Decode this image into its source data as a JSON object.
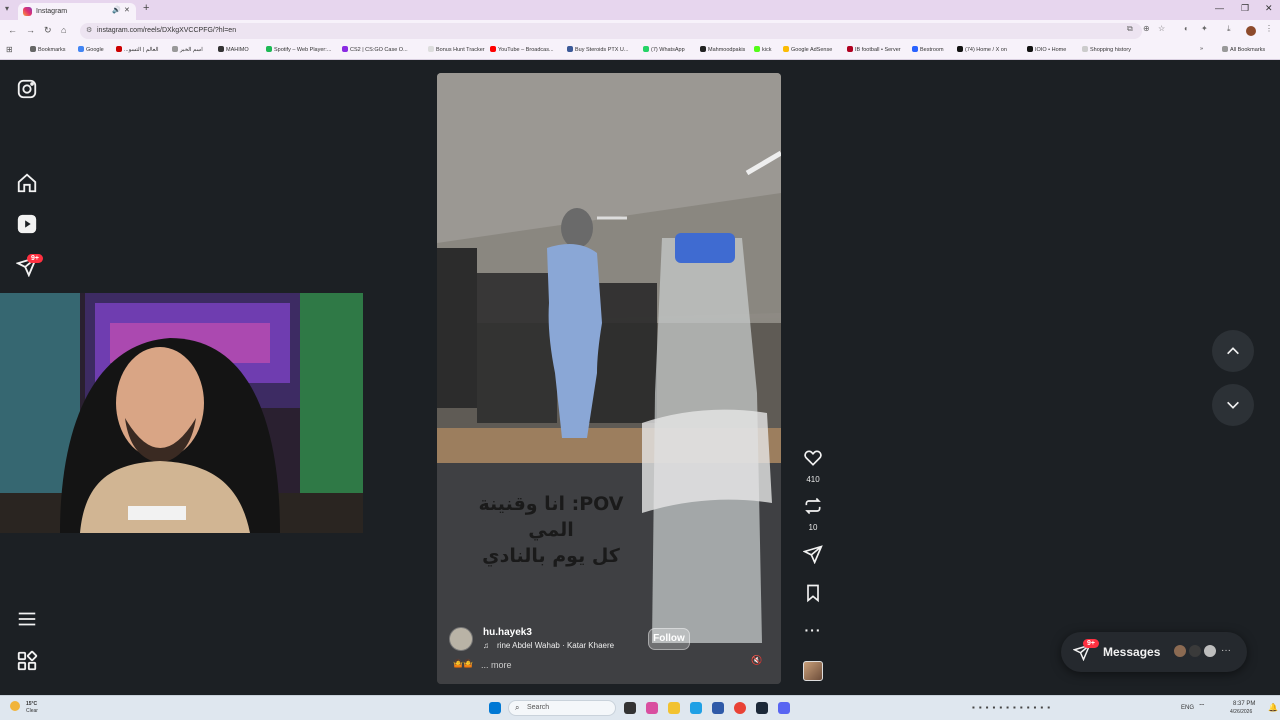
{
  "browser": {
    "tab_title": "Instagram",
    "url": "instagram.com/reels/DXkgXVCCPFG/?hl=en",
    "bookmarks": [
      {
        "label": "Bookmarks",
        "color": "#666"
      },
      {
        "label": "Google",
        "color": "#4285f4"
      },
      {
        "label": "...العالم | التسو",
        "color": "#c00"
      },
      {
        "label": "اسم الخبر",
        "color": "#999"
      },
      {
        "label": "MAHIMO",
        "color": "#333"
      },
      {
        "label": "Spotify – Web Player:...",
        "color": "#1db954"
      },
      {
        "label": "CS2 | CS:GO Case O...",
        "color": "#8a2be2"
      },
      {
        "label": "Bonus Hunt Tracker",
        "color": "#ddd"
      },
      {
        "label": "YouTube – Broadcas...",
        "color": "#ff0000"
      },
      {
        "label": "Buy Steroids PTX U...",
        "color": "#3b5998"
      },
      {
        "label": "(7) WhatsApp",
        "color": "#25d366"
      },
      {
        "label": "Mahmoodpakis",
        "color": "#222"
      },
      {
        "label": "kick",
        "color": "#53fc18"
      },
      {
        "label": "Google AdSense",
        "color": "#fbbc05"
      },
      {
        "label": "IB football • Server",
        "color": "#b00020"
      },
      {
        "label": "Bestroom",
        "color": "#2962ff"
      },
      {
        "label": "(74) Home / X on",
        "color": "#111"
      },
      {
        "label": "IOIO • Home",
        "color": "#111"
      },
      {
        "label": "Shopping history",
        "color": "#ccc"
      }
    ],
    "all_bookmarks": "All Bookmarks"
  },
  "reel": {
    "caption_line1": "POV: انا وقنينة المي",
    "caption_line2": "كل يوم بالنادي",
    "username": "hu.hayek3",
    "audio": "rine Abdel Wahab · Katar Khaere",
    "follow": "Follow",
    "more": "... more",
    "likes": "410",
    "reposts": "10"
  },
  "nav": {
    "notifications_badge": "9+"
  },
  "messages": {
    "label": "Messages",
    "badge": "9+"
  },
  "taskbar": {
    "weather_temp": "15°C",
    "weather_desc": "Clear",
    "search": "Search",
    "lang": "ENG",
    "time": "8:37 PM",
    "date": "4/26/2026"
  }
}
